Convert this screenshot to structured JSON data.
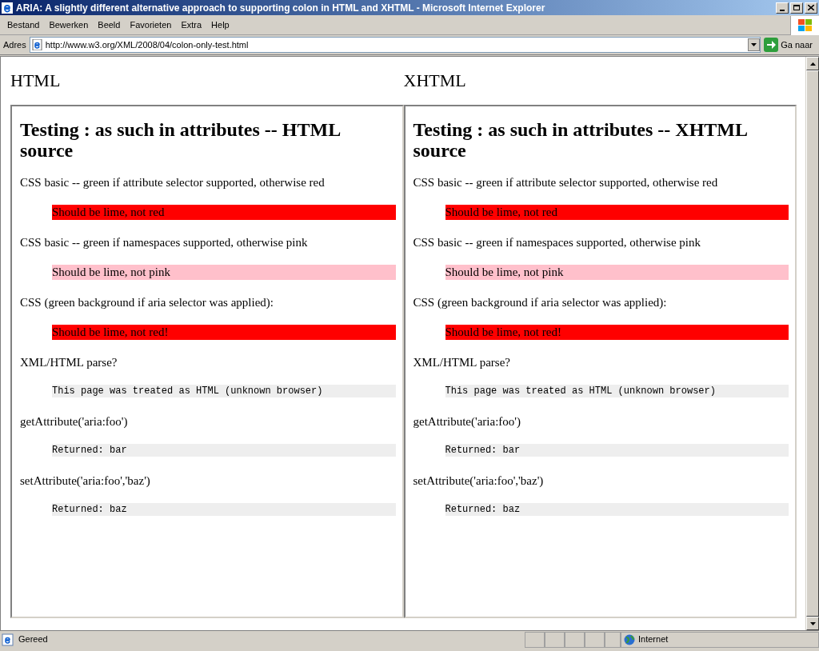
{
  "window": {
    "title": "ARIA: A slightly different alternative approach to supporting colon in HTML and XHTML - Microsoft Internet Explorer"
  },
  "menu": [
    "Bestand",
    "Bewerken",
    "Beeld",
    "Favorieten",
    "Extra",
    "Help"
  ],
  "address_bar": {
    "label": "Adres",
    "value": "http://www.w3.org/XML/2008/04/colon-only-test.html",
    "go_button": "Ga naar"
  },
  "frames": [
    {
      "label": "HTML",
      "heading": "Testing : as such in attributes -- HTML source",
      "tests": [
        {
          "text": "CSS basic -- green if attribute selector supported, otherwise red",
          "kind": "swatch",
          "result": "Should be lime, not red",
          "color": "#ff0000"
        },
        {
          "text": "CSS basic -- green if namespaces supported, otherwise pink",
          "kind": "swatch",
          "result": "Should be lime, not pink",
          "color": "#ffc0cb"
        },
        {
          "text": "CSS (green background if aria selector was applied):",
          "kind": "swatch",
          "result": "Should be lime, not red!",
          "color": "#ff0000"
        },
        {
          "text": "XML/HTML parse?",
          "kind": "code",
          "result": "This page was treated as HTML (unknown browser)"
        },
        {
          "text": "getAttribute('aria:foo')",
          "kind": "code",
          "result": "Returned: bar"
        },
        {
          "text": "setAttribute('aria:foo','baz')",
          "kind": "code",
          "result": "Returned: baz"
        }
      ]
    },
    {
      "label": "XHTML",
      "heading": "Testing : as such in attributes -- XHTML source",
      "tests": [
        {
          "text": "CSS basic -- green if attribute selector supported, otherwise red",
          "kind": "swatch",
          "result": "Should be lime, not red",
          "color": "#ff0000"
        },
        {
          "text": "CSS basic -- green if namespaces supported, otherwise pink",
          "kind": "swatch",
          "result": "Should be lime, not pink",
          "color": "#ffc0cb"
        },
        {
          "text": "CSS (green background if aria selector was applied):",
          "kind": "swatch",
          "result": "Should be lime, not red!",
          "color": "#ff0000"
        },
        {
          "text": "XML/HTML parse?",
          "kind": "code",
          "result": "This page was treated as HTML (unknown browser)"
        },
        {
          "text": "getAttribute('aria:foo')",
          "kind": "code",
          "result": "Returned: bar"
        },
        {
          "text": "setAttribute('aria:foo','baz')",
          "kind": "code",
          "result": "Returned: baz"
        }
      ]
    }
  ],
  "status_bar": {
    "text": "Gereed",
    "zone": "Internet"
  }
}
